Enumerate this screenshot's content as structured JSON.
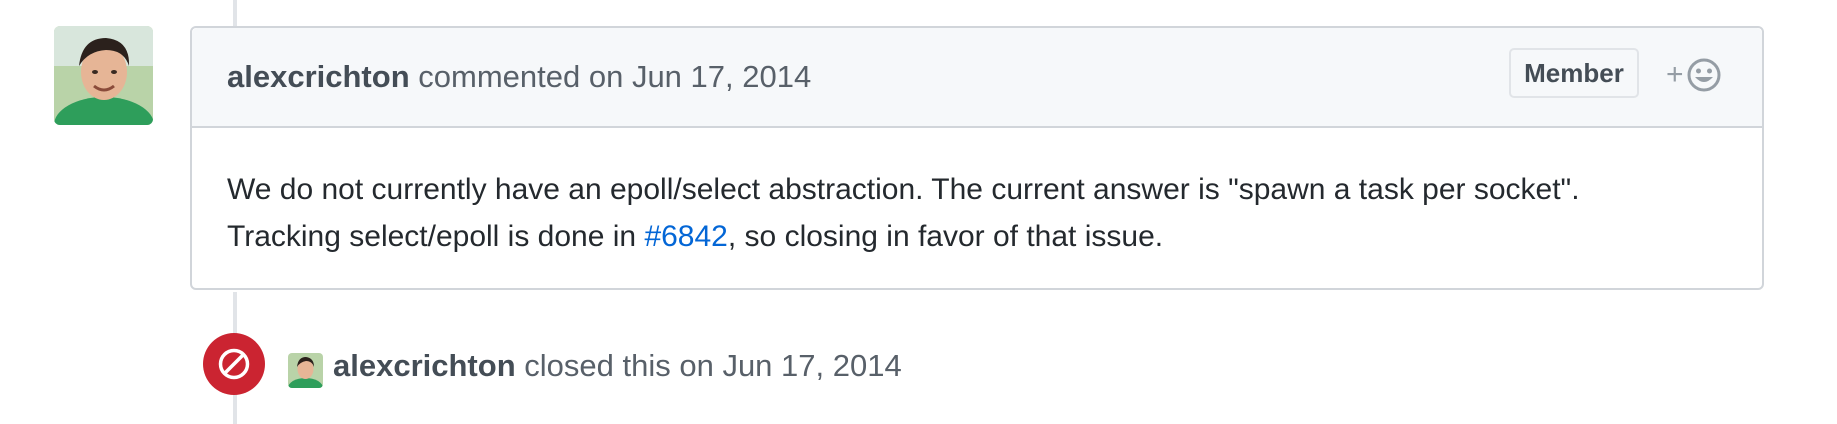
{
  "comment": {
    "author": "alexcrichton",
    "action": "commented on",
    "timestamp": "Jun 17, 2014",
    "role_badge": "Member",
    "reaction_icon": "smiley-icon",
    "body": {
      "line1": "We do not currently have an epoll/select abstraction. The current answer is \"spawn a task per socket\".",
      "line2_before": "Tracking select/epoll is done in ",
      "issue_link": "#6842",
      "line2_after": ", so closing in favor of that issue."
    }
  },
  "event": {
    "icon": "circle-slash-icon",
    "actor": "alexcrichton",
    "action": "closed this on",
    "timestamp": "Jun 17, 2014"
  },
  "colors": {
    "closed": "#cb2431",
    "link": "#0366d6",
    "header_bg": "#f6f8fa",
    "border": "#d1d5da"
  }
}
